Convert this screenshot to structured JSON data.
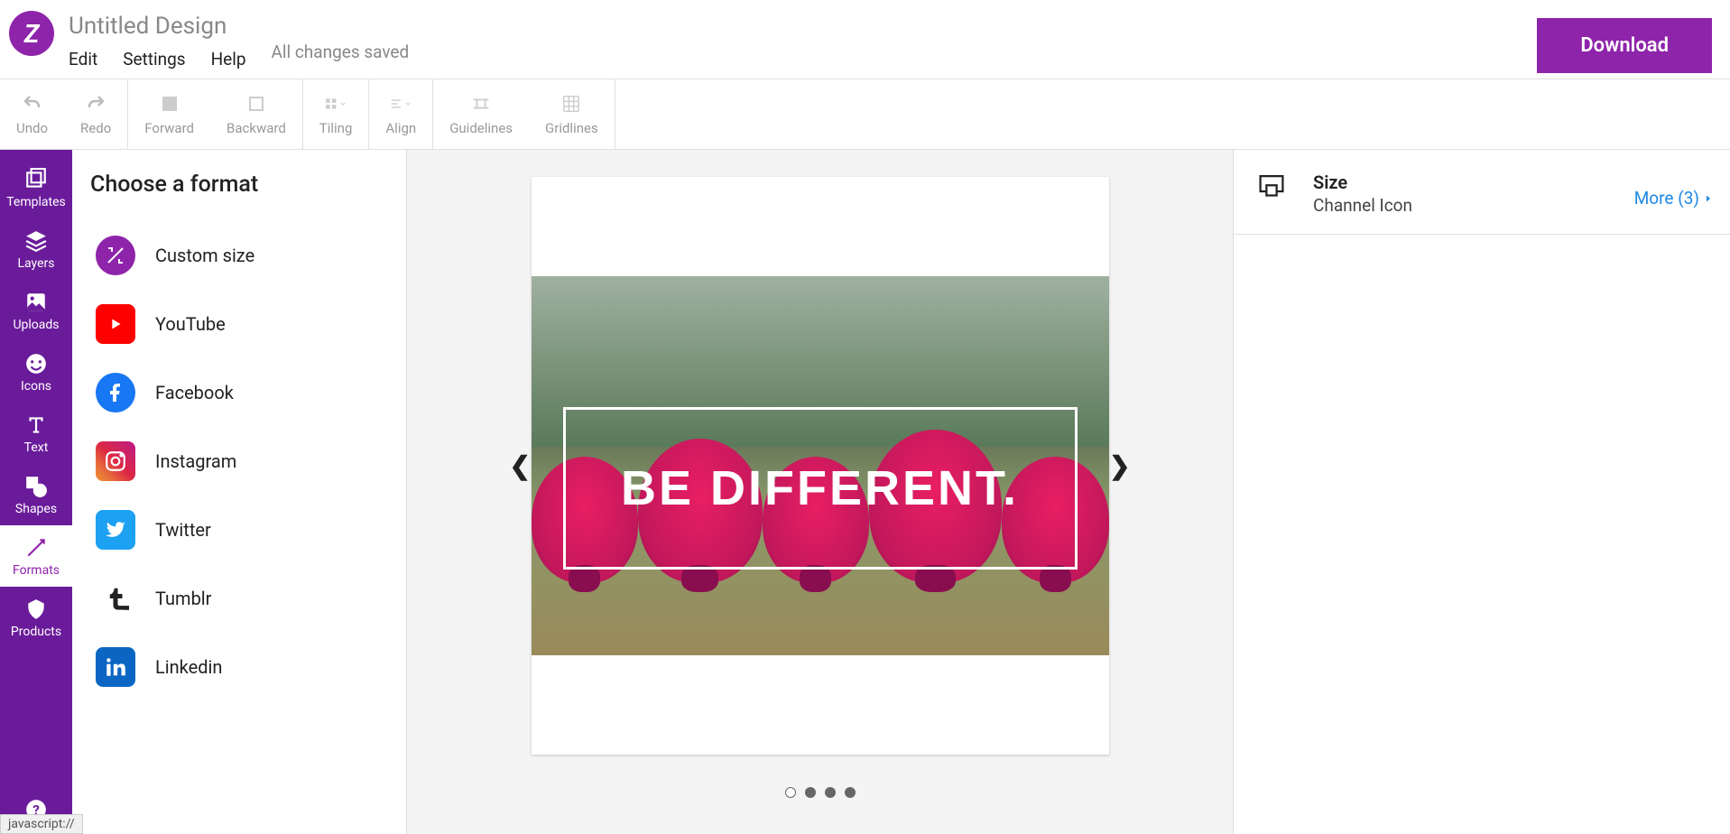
{
  "header": {
    "title": "Untitled Design",
    "menu": {
      "edit": "Edit",
      "settings": "Settings",
      "help": "Help"
    },
    "save_status": "All changes saved",
    "download": "Download"
  },
  "toolbar": {
    "undo": "Undo",
    "redo": "Redo",
    "forward": "Forward",
    "backward": "Backward",
    "tiling": "Tiling",
    "align": "Align",
    "guidelines": "Guidelines",
    "gridlines": "Gridlines"
  },
  "rail": {
    "templates": "Templates",
    "layers": "Layers",
    "uploads": "Uploads",
    "icons": "Icons",
    "text": "Text",
    "shapes": "Shapes",
    "formats": "Formats",
    "products": "Products"
  },
  "format_panel": {
    "title": "Choose a format",
    "items": [
      {
        "label": "Custom size"
      },
      {
        "label": "YouTube"
      },
      {
        "label": "Facebook"
      },
      {
        "label": "Instagram"
      },
      {
        "label": "Twitter"
      },
      {
        "label": "Tumblr"
      },
      {
        "label": "Linkedin"
      }
    ]
  },
  "canvas": {
    "text": "BE DIFFERENT."
  },
  "right": {
    "size_label": "Size",
    "size_value": "Channel Icon",
    "more": "More (3)"
  },
  "status": "javascript://"
}
